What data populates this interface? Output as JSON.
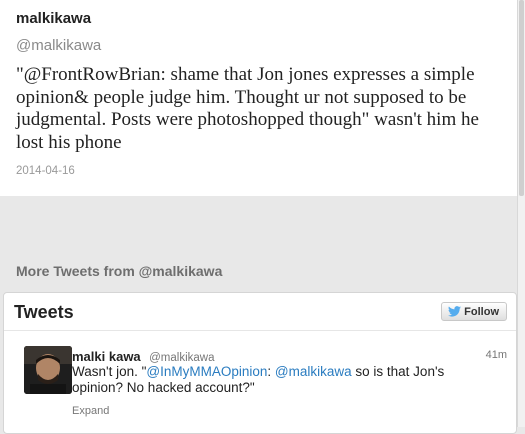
{
  "tweet": {
    "author_name": "malkikawa",
    "author_handle": "@malkikawa",
    "text": "\"@FrontRowBrian: shame that Jon jones expresses a simple opinion& people judge him. Thought ur not supposed to be judgmental. Posts were photoshopped though\" wasn't him he lost his phone",
    "date": "2014-04-16"
  },
  "more_tweets": {
    "heading": "More Tweets from @malkikawa"
  },
  "widget": {
    "title": "Tweets",
    "follow_label": "Follow",
    "items": [
      {
        "name": "malki kawa",
        "handle": "@malkikawa",
        "time": "41m",
        "text_1": "Wasn't jon. \"",
        "mention_1": "@InMyMMAOpinion",
        "text_2": ": ",
        "mention_2": "@malkikawa",
        "text_3": " so is that Jon's opinion? No hacked account?\"",
        "expand_label": "Expand"
      }
    ]
  },
  "colors": {
    "link": "#2a7cc0",
    "twitter_bird": "#55acee"
  },
  "icons": [
    "twitter-bird-icon"
  ]
}
